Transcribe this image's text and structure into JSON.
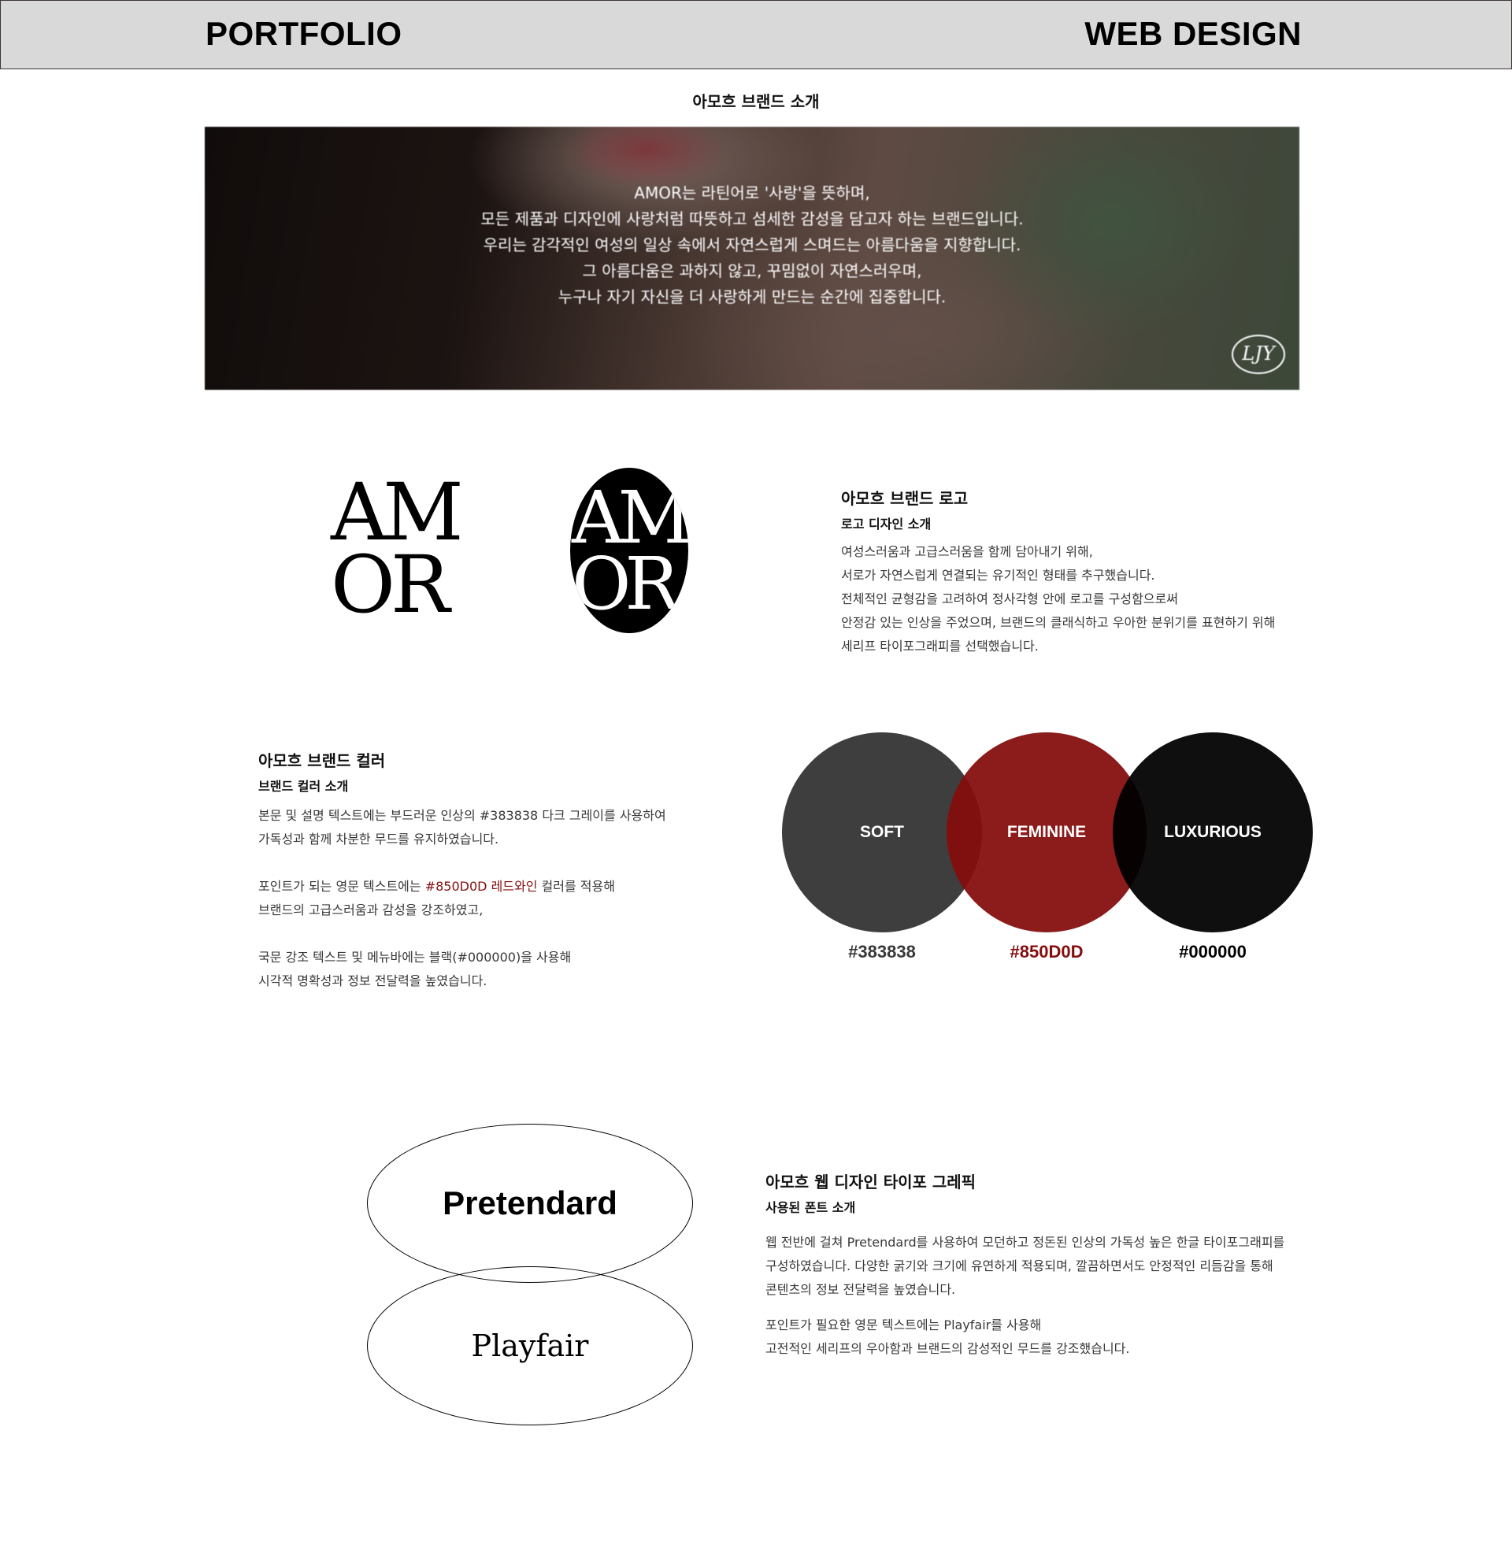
{
  "header": {
    "left_label": "PORTFOLIO",
    "right_label": "WEB DESIGN"
  },
  "intro": {
    "title": "아모흐 브랜드 소개",
    "hero_lines": [
      "AMOR는 라틴어로 '사랑'을 뜻하며,",
      "모든 제품과 디자인에 사랑처럼 따뜻하고 섬세한 감성을 담고자 하는 브랜드입니다.",
      "우리는 감각적인 여성의 일상 속에서 자연스럽게 스며드는 아름다움을 지향합니다.",
      "그 아름다움은 과하지 않고, 꾸밈없이 자연스러우며,",
      "누구나 자기 자신을 더 사랑하게 만드는 순간에 집중합니다."
    ],
    "badge": "LJY"
  },
  "logo": {
    "plain_line1": "AM",
    "plain_line2": "OR",
    "oval_line1": "AM",
    "oval_line2": "OR",
    "title": "아모흐 브랜드 로고",
    "subtitle": "로고 디자인 소개",
    "body": [
      "여성스러움과 고급스러움을 함께 담아내기 위해,",
      "서로가 자연스럽게 연결되는 유기적인 형태를 추구했습니다.",
      " 전체적인 균형감을 고려하여 정사각형 안에 로고를 구성함으로써",
      " 안정감 있는 인상을 주었으며,  브랜드의 클래식하고 우아한 분위기를 표현하기 위해",
      "세리프 타이포그래피를 선택했습니다."
    ]
  },
  "color": {
    "title": "아모흐 브랜드 컬러",
    "subtitle": "브랜드 컬러 소개",
    "body1": [
      "본문 및 설명 텍스트에는 부드러운 인상의 #383838 다크 그레이를 사용하여",
      " 가독성과 함께 차분한 무드를 유지하였습니다."
    ],
    "body2_prefix": " 포인트가 되는 영문 텍스트에는 ",
    "body2_highlight": "#850D0D 레드와인",
    "body2_suffix": " 컬러를 적용해",
    "body2_line2": " 브랜드의 고급스러움과 감성을 강조하였고,",
    "body3": [
      " 국문 강조 텍스트 및 메뉴바에는 블랙(#000000)을 사용해",
      " 시각적 명확성과 정보 전달력을 높였습니다."
    ],
    "swatches": [
      {
        "label": "SOFT",
        "hex": "#383838"
      },
      {
        "label": "FEMININE",
        "hex": "#850D0D"
      },
      {
        "label": "LUXURIOUS",
        "hex": "#000000"
      }
    ]
  },
  "typography": {
    "font1": "Pretendard",
    "font2": "Playfair",
    "title": "아모흐 웹 디자인 타이포 그레픽",
    "subtitle": "사용된 폰트 소개",
    "body1": [
      "웹 전반에 걸쳐 Pretendard를 사용하여 모던하고 정돈된 인상의 가독성 높은 한글 타이포그래피를",
      "구성하였습니다.  다양한 굵기와 크기에 유연하게 적용되며, 깔끔하면서도 안정적인 리듬감을 통해",
      "콘텐츠의 정보 전달력을 높였습니다."
    ],
    "body2": [
      "포인트가 필요한 영문 텍스트에는 Playfair를 사용해",
      " 고전적인 세리프의 우아함과 브랜드의 감성적인 무드를 강조했습니다."
    ]
  }
}
